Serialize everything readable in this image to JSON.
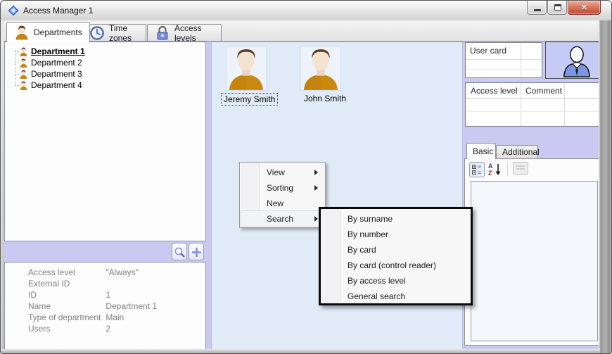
{
  "window": {
    "title": "Access Manager 1"
  },
  "tabs": {
    "items": [
      {
        "label": "Departments",
        "icon": "person-icon",
        "active": true
      },
      {
        "label": "Time zones",
        "icon": "clock-icon",
        "active": false
      },
      {
        "label": "Access levels",
        "icon": "lock-icon",
        "active": false
      }
    ]
  },
  "tree": {
    "items": [
      {
        "label": "Department 1",
        "selected": true
      },
      {
        "label": "Department 2",
        "selected": false
      },
      {
        "label": "Department 3",
        "selected": false
      },
      {
        "label": "Department 4",
        "selected": false
      }
    ]
  },
  "users": {
    "items": [
      {
        "name": "Jeremy Smith",
        "selected": true
      },
      {
        "name": "John Smith",
        "selected": false
      }
    ]
  },
  "context_menu": {
    "items": [
      {
        "label": "View",
        "has_submenu": true
      },
      {
        "label": "Sorting",
        "has_submenu": true
      },
      {
        "label": "New",
        "has_submenu": false
      },
      {
        "label": "Search",
        "has_submenu": true,
        "open": true
      }
    ]
  },
  "search_submenu": {
    "items": [
      {
        "label": "By surname"
      },
      {
        "label": "By number"
      },
      {
        "label": "By card"
      },
      {
        "label": "By card (control reader)"
      },
      {
        "label": "By access level"
      },
      {
        "label": "General search"
      }
    ]
  },
  "user_card_grid": {
    "header": "User card"
  },
  "access_table": {
    "col1": "Access level",
    "col2": "Comment"
  },
  "detail_tabs": {
    "basic": "Basic",
    "additional": "Additional"
  },
  "properties": {
    "rows": [
      {
        "label": "Access level",
        "value": "\"Always\""
      },
      {
        "label": "External ID",
        "value": ""
      },
      {
        "label": "ID",
        "value": "1"
      },
      {
        "label": "Name",
        "value": "Department 1"
      },
      {
        "label": "Type of department",
        "value": "Main"
      },
      {
        "label": "Users",
        "value": "2"
      }
    ]
  },
  "colors": {
    "panel_lavender": "#c9c9f2",
    "panel_blue": "#e1eaf7",
    "avatar_shirt": "#c8860d",
    "silhouette_shirt": "#7b96e2",
    "close_button_red": "#bf4a33",
    "submenu_highlight_border": "#0a0a0a",
    "property_text_gray": "#808080"
  }
}
